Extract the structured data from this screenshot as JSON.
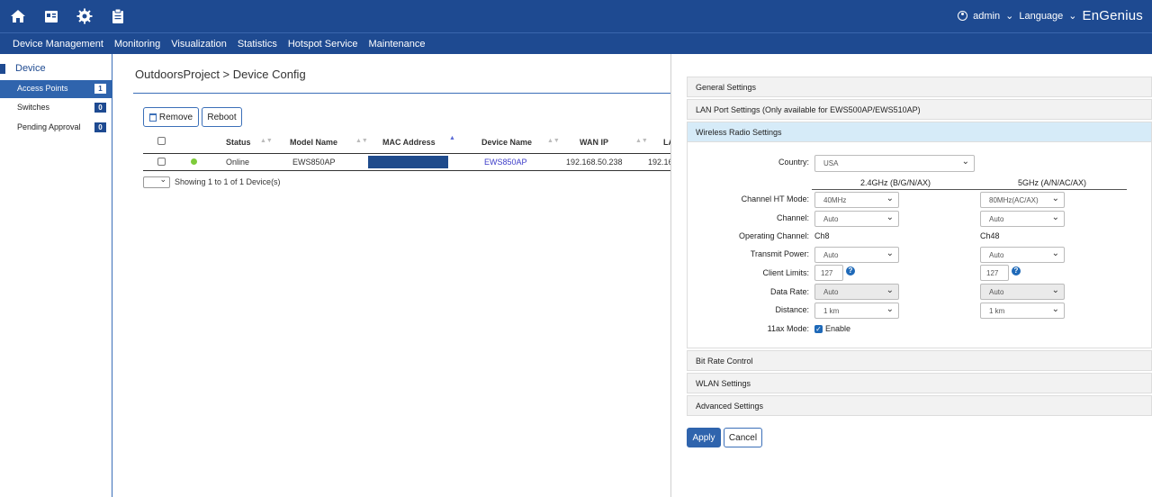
{
  "topbar": {
    "icons": [
      "home-icon",
      "dashboard-icon",
      "gear-icon",
      "clipboard-icon"
    ],
    "user": "admin",
    "language": "Language",
    "brand": "EnGenius"
  },
  "nav": [
    "Device Management",
    "Monitoring",
    "Visualization",
    "Statistics",
    "Hotspot Service",
    "Maintenance"
  ],
  "sidebar": {
    "title": "Device",
    "items": [
      {
        "label": "Access Points",
        "count": "1"
      },
      {
        "label": "Switches",
        "count": "0"
      },
      {
        "label": "Pending Approval",
        "count": "0"
      }
    ]
  },
  "page": {
    "title": "OutdoorsProject > Device Config",
    "remove_label": "Remove",
    "reboot_label": "Reboot"
  },
  "table": {
    "headers": [
      "Status",
      "Model Name",
      "MAC Address",
      "Device Name",
      "WAN IP",
      "LA"
    ],
    "row": {
      "status": "Online",
      "model": "EWS850AP",
      "device_name": "EWS850AP",
      "wan_ip": "192.168.50.238",
      "lan_ip": "192.16"
    },
    "pager_text": "Showing 1 to 1 of 1 Device(s)"
  },
  "panel": {
    "sections": [
      "General Settings",
      "LAN Port Settings (Only available for EWS500AP/EWS510AP)",
      "Wireless Radio Settings",
      "Bit Rate Control",
      "WLAN Settings",
      "Advanced Settings"
    ],
    "country_label": "Country:",
    "country_value": "USA",
    "band_24": "2.4GHz (B/G/N/AX)",
    "band_5": "5GHz (A/N/AC/AX)",
    "labels": {
      "ht_mode": "Channel HT Mode:",
      "channel": "Channel:",
      "op_channel": "Operating Channel:",
      "tx_power": "Transmit Power:",
      "client_limits": "Client Limits:",
      "data_rate": "Data Rate:",
      "distance": "Distance:",
      "ax_mode": "11ax Mode:"
    },
    "b24": {
      "ht_mode": "40MHz",
      "channel": "Auto",
      "op_channel": "Ch8",
      "tx_power": "Auto",
      "client_limits": "127",
      "data_rate": "Auto",
      "distance": "1 km"
    },
    "b5": {
      "ht_mode": "80MHz(AC/AX)",
      "channel": "Auto",
      "op_channel": "Ch48",
      "tx_power": "Auto",
      "client_limits": "127",
      "data_rate": "Auto",
      "distance": "1 km"
    },
    "ax_enable": "Enable",
    "apply_label": "Apply",
    "cancel_label": "Cancel"
  },
  "colors": {
    "header": "#1e4a91",
    "accent": "#2f64ad",
    "online": "#7ecb3b",
    "open_section": "#d6ebf8"
  }
}
